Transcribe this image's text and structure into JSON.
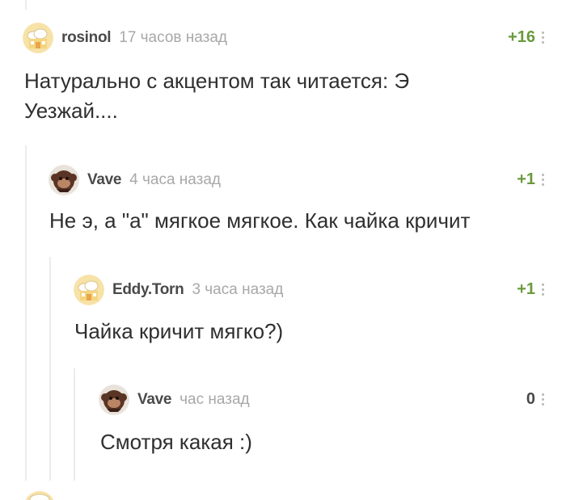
{
  "comments": [
    {
      "username": "rosinol",
      "time": "17 часов назад",
      "rating": "+16",
      "text": "Натурально с акцентом так читается: Э\nУезжай....",
      "avatar_icon": "chef-hat-avatar-icon"
    },
    {
      "username": "Vave",
      "time": "4 часа назад",
      "rating": "+1",
      "text": "Не э, а \"а\" мягкое мягкое. Как чайка кричит",
      "avatar_icon": "monkey-avatar-icon"
    },
    {
      "username": "Eddy.Torn",
      "time": "3 часа назад",
      "rating": "+1",
      "text": "Чайка кричит мягко?)",
      "avatar_icon": "chef-hat-avatar-icon"
    },
    {
      "username": "Vave",
      "time": "час назад",
      "rating": "0",
      "text": "Смотря какая :)",
      "avatar_icon": "monkey-avatar-icon"
    }
  ],
  "colors": {
    "positive_rating": "#6a9a3d",
    "neutral_rating": "#4a4a4a",
    "thread_line": "#ececec",
    "meta_gray": "#a8a8a8"
  }
}
